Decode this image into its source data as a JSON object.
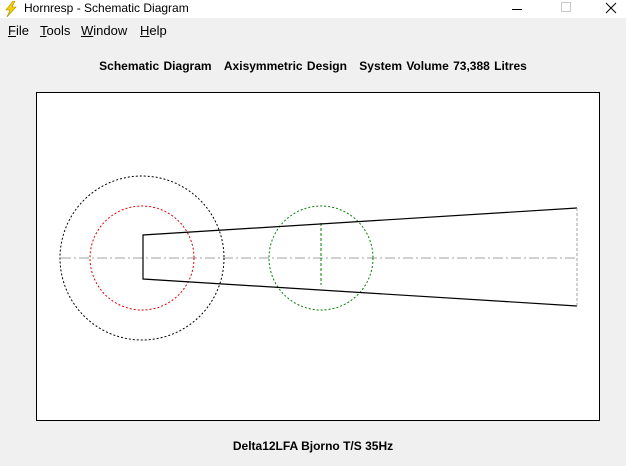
{
  "window": {
    "title": "Hornresp - Schematic Diagram"
  },
  "menu": {
    "file": {
      "mnemonic": "F",
      "rest": "ile"
    },
    "tools": {
      "mnemonic": "T",
      "rest": "ools"
    },
    "window": {
      "mnemonic": "W",
      "rest": "indow"
    },
    "help": {
      "mnemonic": "H",
      "rest": "elp"
    }
  },
  "header": {
    "title": "Schematic Diagram",
    "design": "Axisymmetric Design",
    "volume": "System Volume 73,388 Litres"
  },
  "footer": {
    "text": "Delta12LFA Bjorno T/S 35Hz"
  },
  "colors": {
    "outline": "#000000",
    "chamber_circle": "#e00000",
    "driver_circle": "#008000",
    "centerline": "#a0a0a0"
  }
}
